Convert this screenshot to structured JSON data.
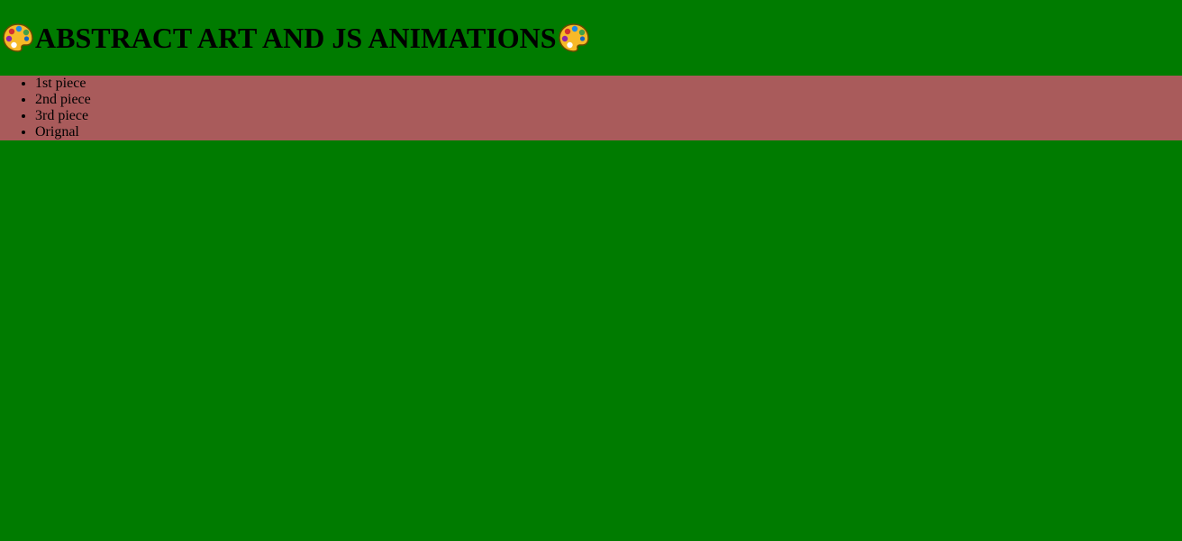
{
  "header": {
    "title": "ABSTRACT ART AND JS ANIMATIONS",
    "left_icon": "palette-icon",
    "right_icon": "palette-icon"
  },
  "nav": {
    "items": [
      {
        "label": "1st piece"
      },
      {
        "label": "2nd piece"
      },
      {
        "label": "3rd piece"
      },
      {
        "label": "Orignal"
      }
    ]
  },
  "colors": {
    "page_background": "#007b00",
    "nav_background": "#a95b5b",
    "text": "#000000"
  }
}
